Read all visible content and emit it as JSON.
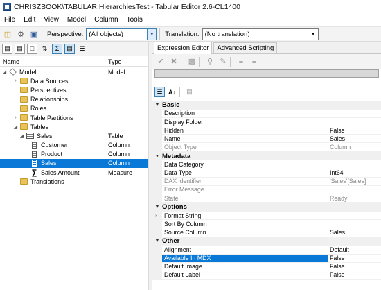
{
  "window": {
    "title": "CHRISZBOOK\\TABULAR.HierarchiesTest - Tabular Editor 2.6-CL1400"
  },
  "menu": [
    "File",
    "Edit",
    "View",
    "Model",
    "Column",
    "Tools"
  ],
  "toolbar": {
    "perspective_label": "Perspective:",
    "perspective_value": "(All objects)",
    "translation_label": "Translation:",
    "translation_value": "(No translation)"
  },
  "tree": {
    "headers": {
      "name": "Name",
      "type": "Type"
    },
    "rows": [
      {
        "label": "Model",
        "type": "Model"
      },
      {
        "label": "Data Sources",
        "type": ""
      },
      {
        "label": "Perspectives",
        "type": ""
      },
      {
        "label": "Relationships",
        "type": ""
      },
      {
        "label": "Roles",
        "type": ""
      },
      {
        "label": "Table Partitions",
        "type": ""
      },
      {
        "label": "Tables",
        "type": ""
      },
      {
        "label": "Sales",
        "type": "Table"
      },
      {
        "label": "Customer",
        "type": "Column"
      },
      {
        "label": "Product",
        "type": "Column"
      },
      {
        "label": "Sales",
        "type": "Column"
      },
      {
        "label": "Sales Amount",
        "type": "Measure"
      },
      {
        "label": "Translations",
        "type": ""
      }
    ]
  },
  "tabs": {
    "expression": "Expression Editor",
    "advanced": "Advanced Scripting"
  },
  "properties": {
    "basic": {
      "title": "Basic",
      "rows": [
        {
          "name": "Description",
          "value": ""
        },
        {
          "name": "Display Folder",
          "value": ""
        },
        {
          "name": "Hidden",
          "value": "False"
        },
        {
          "name": "Name",
          "value": "Sales"
        },
        {
          "name": "Object Type",
          "value": "Column"
        }
      ]
    },
    "metadata": {
      "title": "Metadata",
      "rows": [
        {
          "name": "Data Category",
          "value": ""
        },
        {
          "name": "Data Type",
          "value": "Int64"
        },
        {
          "name": "DAX identifier",
          "value": "'Sales'[Sales]"
        },
        {
          "name": "Error Message",
          "value": ""
        },
        {
          "name": "State",
          "value": "Ready"
        }
      ]
    },
    "options": {
      "title": "Options",
      "rows": [
        {
          "name": "Format String",
          "value": ""
        },
        {
          "name": "Sort By Column",
          "value": ""
        },
        {
          "name": "Source Column",
          "value": "Sales"
        }
      ]
    },
    "other": {
      "title": "Other",
      "rows": [
        {
          "name": "Alignment",
          "value": "Default"
        },
        {
          "name": "Available In MDX",
          "value": "False"
        },
        {
          "name": "Default Image",
          "value": "False"
        },
        {
          "name": "Default Label",
          "value": "False"
        }
      ]
    }
  },
  "colors": {
    "selection": "#0a78d7",
    "folder": "#e8c35b"
  }
}
